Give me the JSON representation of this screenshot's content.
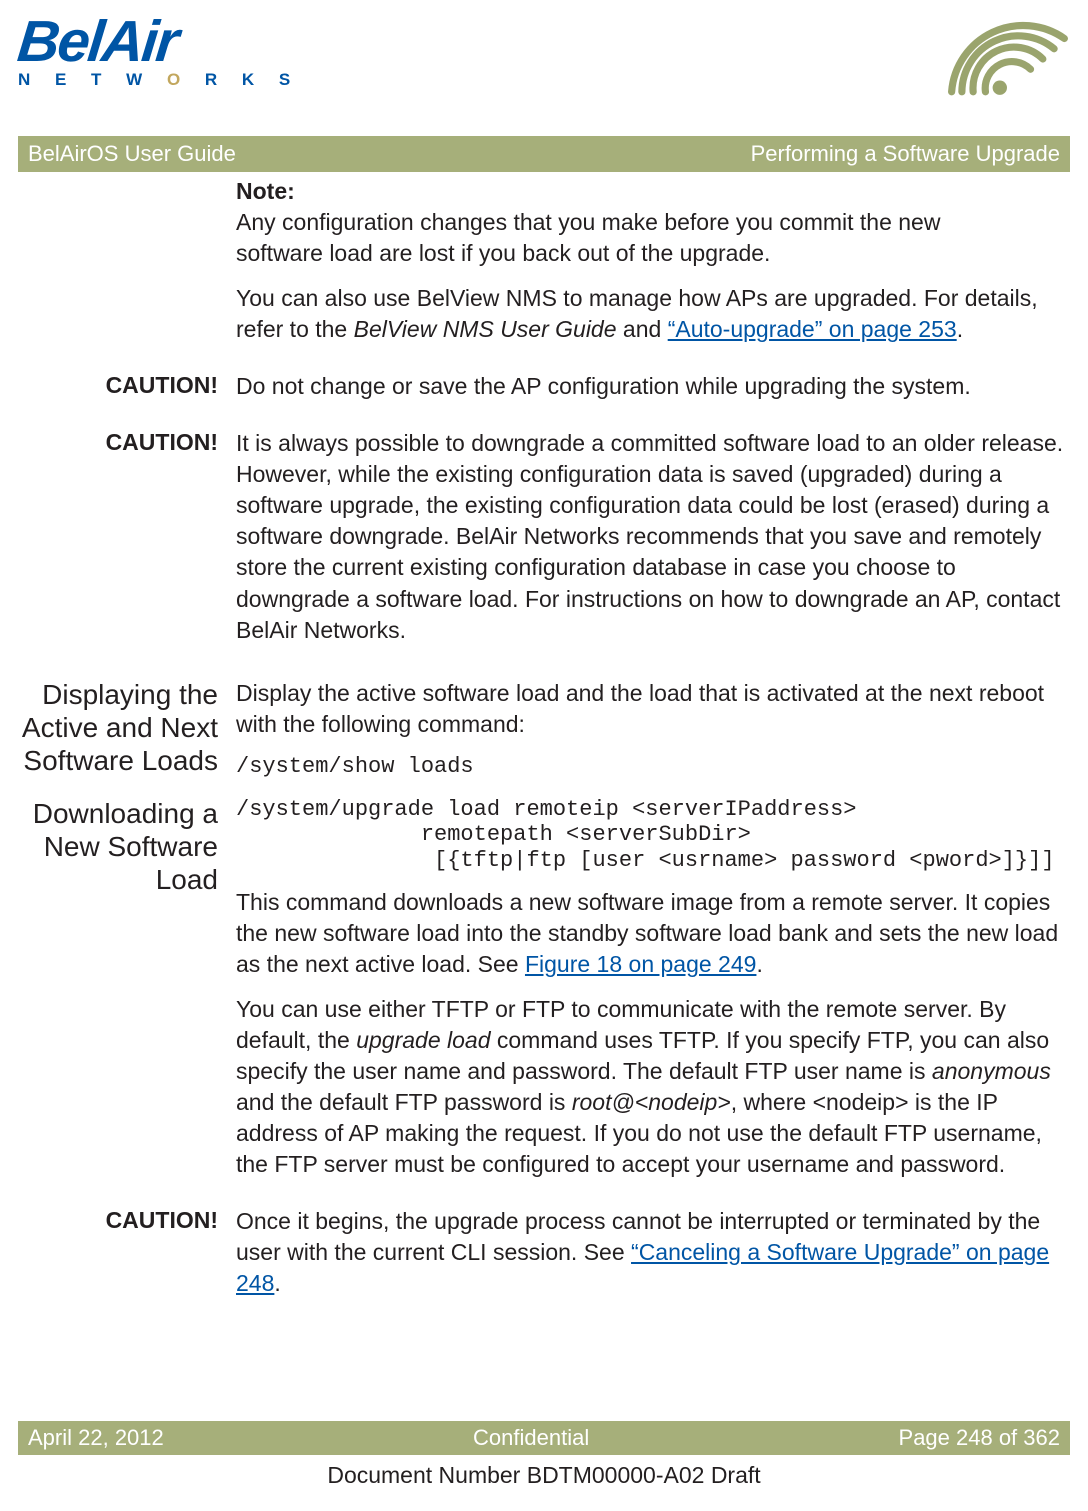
{
  "logo": {
    "main": "BelAir",
    "sub_pre": "N E T W ",
    "sub_accent": "O",
    "sub_post": " R K S"
  },
  "titlebar": {
    "left": "BelAirOS User Guide",
    "right": "Performing a Software Upgrade"
  },
  "note": {
    "label": "Note:",
    "text": "Any configuration changes that you make before you commit the new software load are lost if you back out of the upgrade."
  },
  "intro_para": {
    "pre": "You can also use BelView NMS to manage how APs are upgraded. For details, refer to the ",
    "ital": "BelView NMS User Guide",
    "mid": " and ",
    "link": "“Auto-upgrade” on page 253",
    "post": "."
  },
  "caution1": {
    "label": "CAUTION!",
    "text": "Do not change or save the AP configuration while upgrading the system."
  },
  "caution2": {
    "label": "CAUTION!",
    "text": "It is always possible to downgrade a committed software load to an older release. However, while the existing configuration data is saved (upgraded) during a software upgrade, the existing configuration data could be lost (erased) during a software downgrade. BelAir Networks recommends that you save and remotely store the current existing configuration database in case you choose to downgrade a software load. For instructions on how to downgrade an AP, contact BelAir Networks."
  },
  "section1": {
    "head": "Displaying the Active and Next Software Loads",
    "para": "Display the active software load and the load that is activated at the next reboot with the following command:",
    "cmd": "/system/show loads"
  },
  "section2": {
    "head": "Downloading a New Software Load",
    "cmd": "/system/upgrade load remoteip <serverIPaddress>\n              remotepath <serverSubDir>\n               [{tftp|ftp [user <usrname> password <pword>]}]]",
    "p1_pre": "This command downloads a new software image from a remote server. It copies the new software load into the standby software load bank and sets the new load as the next active load. See ",
    "p1_link": "Figure 18 on page 249",
    "p1_post": ".",
    "p2_a": "You can use either TFTP or FTP to communicate with the remote server. By default, the ",
    "p2_i1": "upgrade load",
    "p2_b": " command uses TFTP. If you specify FTP, you can also specify the user name and password. The default FTP user name is ",
    "p2_i2": "anonymous",
    "p2_c": " and the default FTP password is ",
    "p2_i3": "root@<nodeip>",
    "p2_d": ", where <nodeip> is the IP address of AP making the request. If you do not use the default FTP username, the FTP server must be configured to accept your username and password."
  },
  "caution3": {
    "label": "CAUTION!",
    "pre": "Once it begins, the upgrade process cannot be interrupted or terminated by the user with the current CLI session. See ",
    "link": "“Canceling a Software Upgrade” on page 248",
    "post": "."
  },
  "footer": {
    "left": "April 22, 2012",
    "center": "Confidential",
    "right": "Page 248 of 362"
  },
  "docnum": "Document Number BDTM00000-A02 Draft"
}
